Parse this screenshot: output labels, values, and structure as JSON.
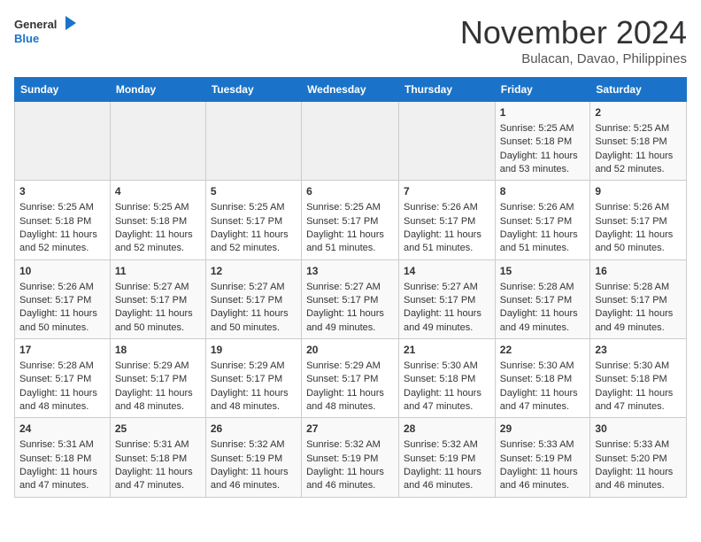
{
  "logo": {
    "line1": "General",
    "line2": "Blue"
  },
  "title": "November 2024",
  "location": "Bulacan, Davao, Philippines",
  "weekdays": [
    "Sunday",
    "Monday",
    "Tuesday",
    "Wednesday",
    "Thursday",
    "Friday",
    "Saturday"
  ],
  "weeks": [
    [
      {
        "day": "",
        "sunrise": "",
        "sunset": "",
        "daylight": ""
      },
      {
        "day": "",
        "sunrise": "",
        "sunset": "",
        "daylight": ""
      },
      {
        "day": "",
        "sunrise": "",
        "sunset": "",
        "daylight": ""
      },
      {
        "day": "",
        "sunrise": "",
        "sunset": "",
        "daylight": ""
      },
      {
        "day": "",
        "sunrise": "",
        "sunset": "",
        "daylight": ""
      },
      {
        "day": "1",
        "sunrise": "Sunrise: 5:25 AM",
        "sunset": "Sunset: 5:18 PM",
        "daylight": "Daylight: 11 hours and 53 minutes."
      },
      {
        "day": "2",
        "sunrise": "Sunrise: 5:25 AM",
        "sunset": "Sunset: 5:18 PM",
        "daylight": "Daylight: 11 hours and 52 minutes."
      }
    ],
    [
      {
        "day": "3",
        "sunrise": "Sunrise: 5:25 AM",
        "sunset": "Sunset: 5:18 PM",
        "daylight": "Daylight: 11 hours and 52 minutes."
      },
      {
        "day": "4",
        "sunrise": "Sunrise: 5:25 AM",
        "sunset": "Sunset: 5:18 PM",
        "daylight": "Daylight: 11 hours and 52 minutes."
      },
      {
        "day": "5",
        "sunrise": "Sunrise: 5:25 AM",
        "sunset": "Sunset: 5:17 PM",
        "daylight": "Daylight: 11 hours and 52 minutes."
      },
      {
        "day": "6",
        "sunrise": "Sunrise: 5:25 AM",
        "sunset": "Sunset: 5:17 PM",
        "daylight": "Daylight: 11 hours and 51 minutes."
      },
      {
        "day": "7",
        "sunrise": "Sunrise: 5:26 AM",
        "sunset": "Sunset: 5:17 PM",
        "daylight": "Daylight: 11 hours and 51 minutes."
      },
      {
        "day": "8",
        "sunrise": "Sunrise: 5:26 AM",
        "sunset": "Sunset: 5:17 PM",
        "daylight": "Daylight: 11 hours and 51 minutes."
      },
      {
        "day": "9",
        "sunrise": "Sunrise: 5:26 AM",
        "sunset": "Sunset: 5:17 PM",
        "daylight": "Daylight: 11 hours and 50 minutes."
      }
    ],
    [
      {
        "day": "10",
        "sunrise": "Sunrise: 5:26 AM",
        "sunset": "Sunset: 5:17 PM",
        "daylight": "Daylight: 11 hours and 50 minutes."
      },
      {
        "day": "11",
        "sunrise": "Sunrise: 5:27 AM",
        "sunset": "Sunset: 5:17 PM",
        "daylight": "Daylight: 11 hours and 50 minutes."
      },
      {
        "day": "12",
        "sunrise": "Sunrise: 5:27 AM",
        "sunset": "Sunset: 5:17 PM",
        "daylight": "Daylight: 11 hours and 50 minutes."
      },
      {
        "day": "13",
        "sunrise": "Sunrise: 5:27 AM",
        "sunset": "Sunset: 5:17 PM",
        "daylight": "Daylight: 11 hours and 49 minutes."
      },
      {
        "day": "14",
        "sunrise": "Sunrise: 5:27 AM",
        "sunset": "Sunset: 5:17 PM",
        "daylight": "Daylight: 11 hours and 49 minutes."
      },
      {
        "day": "15",
        "sunrise": "Sunrise: 5:28 AM",
        "sunset": "Sunset: 5:17 PM",
        "daylight": "Daylight: 11 hours and 49 minutes."
      },
      {
        "day": "16",
        "sunrise": "Sunrise: 5:28 AM",
        "sunset": "Sunset: 5:17 PM",
        "daylight": "Daylight: 11 hours and 49 minutes."
      }
    ],
    [
      {
        "day": "17",
        "sunrise": "Sunrise: 5:28 AM",
        "sunset": "Sunset: 5:17 PM",
        "daylight": "Daylight: 11 hours and 48 minutes."
      },
      {
        "day": "18",
        "sunrise": "Sunrise: 5:29 AM",
        "sunset": "Sunset: 5:17 PM",
        "daylight": "Daylight: 11 hours and 48 minutes."
      },
      {
        "day": "19",
        "sunrise": "Sunrise: 5:29 AM",
        "sunset": "Sunset: 5:17 PM",
        "daylight": "Daylight: 11 hours and 48 minutes."
      },
      {
        "day": "20",
        "sunrise": "Sunrise: 5:29 AM",
        "sunset": "Sunset: 5:17 PM",
        "daylight": "Daylight: 11 hours and 48 minutes."
      },
      {
        "day": "21",
        "sunrise": "Sunrise: 5:30 AM",
        "sunset": "Sunset: 5:18 PM",
        "daylight": "Daylight: 11 hours and 47 minutes."
      },
      {
        "day": "22",
        "sunrise": "Sunrise: 5:30 AM",
        "sunset": "Sunset: 5:18 PM",
        "daylight": "Daylight: 11 hours and 47 minutes."
      },
      {
        "day": "23",
        "sunrise": "Sunrise: 5:30 AM",
        "sunset": "Sunset: 5:18 PM",
        "daylight": "Daylight: 11 hours and 47 minutes."
      }
    ],
    [
      {
        "day": "24",
        "sunrise": "Sunrise: 5:31 AM",
        "sunset": "Sunset: 5:18 PM",
        "daylight": "Daylight: 11 hours and 47 minutes."
      },
      {
        "day": "25",
        "sunrise": "Sunrise: 5:31 AM",
        "sunset": "Sunset: 5:18 PM",
        "daylight": "Daylight: 11 hours and 47 minutes."
      },
      {
        "day": "26",
        "sunrise": "Sunrise: 5:32 AM",
        "sunset": "Sunset: 5:19 PM",
        "daylight": "Daylight: 11 hours and 46 minutes."
      },
      {
        "day": "27",
        "sunrise": "Sunrise: 5:32 AM",
        "sunset": "Sunset: 5:19 PM",
        "daylight": "Daylight: 11 hours and 46 minutes."
      },
      {
        "day": "28",
        "sunrise": "Sunrise: 5:32 AM",
        "sunset": "Sunset: 5:19 PM",
        "daylight": "Daylight: 11 hours and 46 minutes."
      },
      {
        "day": "29",
        "sunrise": "Sunrise: 5:33 AM",
        "sunset": "Sunset: 5:19 PM",
        "daylight": "Daylight: 11 hours and 46 minutes."
      },
      {
        "day": "30",
        "sunrise": "Sunrise: 5:33 AM",
        "sunset": "Sunset: 5:20 PM",
        "daylight": "Daylight: 11 hours and 46 minutes."
      }
    ]
  ]
}
